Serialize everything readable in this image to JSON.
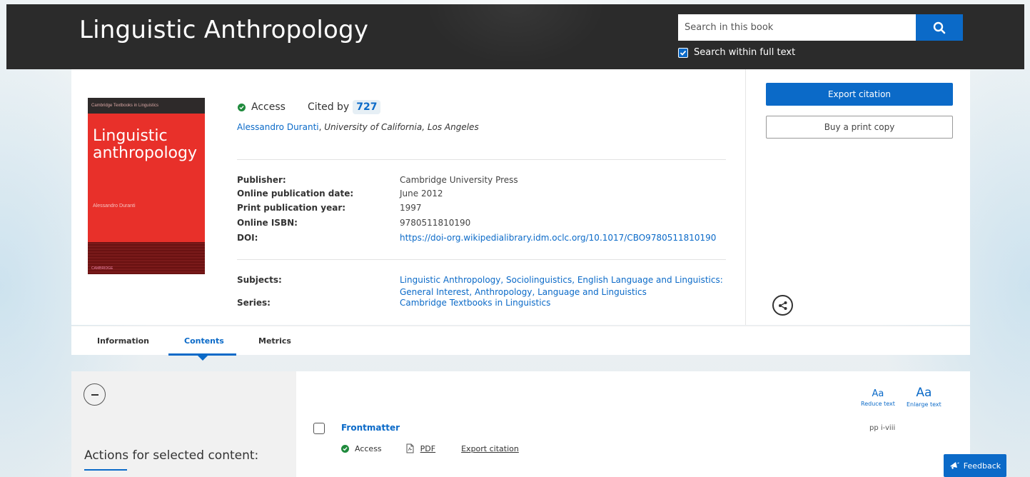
{
  "header": {
    "title": "Linguistic Anthropology",
    "search_placeholder": "Search in this book",
    "search_full_text_label": "Search within full text",
    "search_full_text_checked": true
  },
  "book": {
    "access_label": "Access",
    "cited_by_label": "Cited by",
    "cited_by_count": "727",
    "author": "Alessandro Duranti",
    "author_separator": ",",
    "affiliation": "University of California, Los Angeles",
    "cover": {
      "series_banner": "Cambridge Textbooks in Linguistics",
      "title_line1": "Linguistic",
      "title_line2": "anthropology",
      "author": "Alessandro Duranti",
      "publisher_mark": "CAMBRIDGE"
    },
    "metadata": [
      {
        "label": "Publisher:",
        "value": "Cambridge University Press"
      },
      {
        "label": "Online publication date:",
        "value": "June 2012"
      },
      {
        "label": "Print publication year:",
        "value": "1997"
      },
      {
        "label": "Online ISBN:",
        "value": "9780511810190"
      },
      {
        "label": "DOI:",
        "value": "https://doi-org.wikipedialibrary.idm.oclc.org/10.1017/CBO9780511810190"
      }
    ],
    "subjects_label": "Subjects:",
    "subjects_line1": "Linguistic Anthropology, Sociolinguistics, English Language and Linguistics:",
    "subjects_line2": "General Interest, Anthropology, Language and Linguistics",
    "series_label": "Series:",
    "series_value": "Cambridge Textbooks in Linguistics"
  },
  "sidebar": {
    "export_citation": "Export citation",
    "buy_print_copy": "Buy a print copy"
  },
  "tabs": [
    {
      "label": "Information",
      "active": false
    },
    {
      "label": "Contents",
      "active": true
    },
    {
      "label": "Metrics",
      "active": false
    }
  ],
  "contents": {
    "actions_label": "Actions for selected content:",
    "reduce_text_glyph": "Aa",
    "reduce_text_label": "Reduce text",
    "enlarge_text_glyph": "Aa",
    "enlarge_text_label": "Enlarge text",
    "items": [
      {
        "title": "Frontmatter",
        "pages": "pp i-viii",
        "access_label": "Access",
        "pdf_label": "PDF",
        "export_label": "Export citation"
      }
    ]
  },
  "feedback_label": "Feedback",
  "colors": {
    "brand_blue": "#0b6ac8",
    "header_dark": "#2b2b2b",
    "access_green": "#1f8a3c"
  }
}
